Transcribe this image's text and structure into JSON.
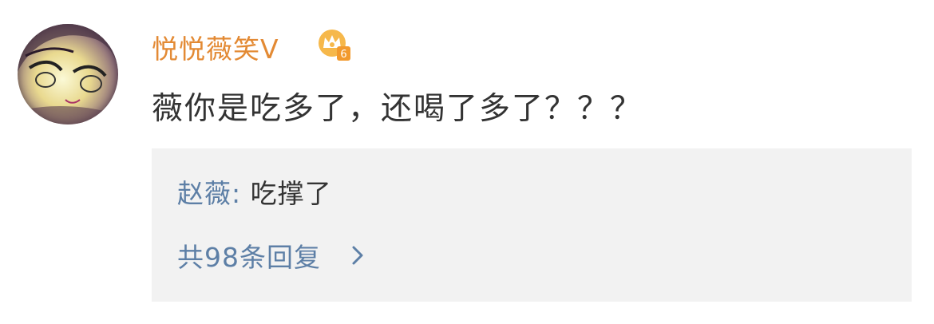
{
  "comment": {
    "username": "悦悦薇笑V",
    "vip_level": "6",
    "text": "薇你是吃多了，还喝了多了？？？"
  },
  "reply": {
    "author": "赵薇",
    "separator": ":",
    "content": "吃撑了",
    "count_label": "共98条回复"
  },
  "icons": {
    "avatar": "anime-avatar",
    "badge": "vip-crown-icon",
    "more": "chevron-right-icon"
  },
  "colors": {
    "username": "#e38a34",
    "link": "#5d7fa6",
    "text": "#333333",
    "reply_bg": "#f2f2f2"
  }
}
